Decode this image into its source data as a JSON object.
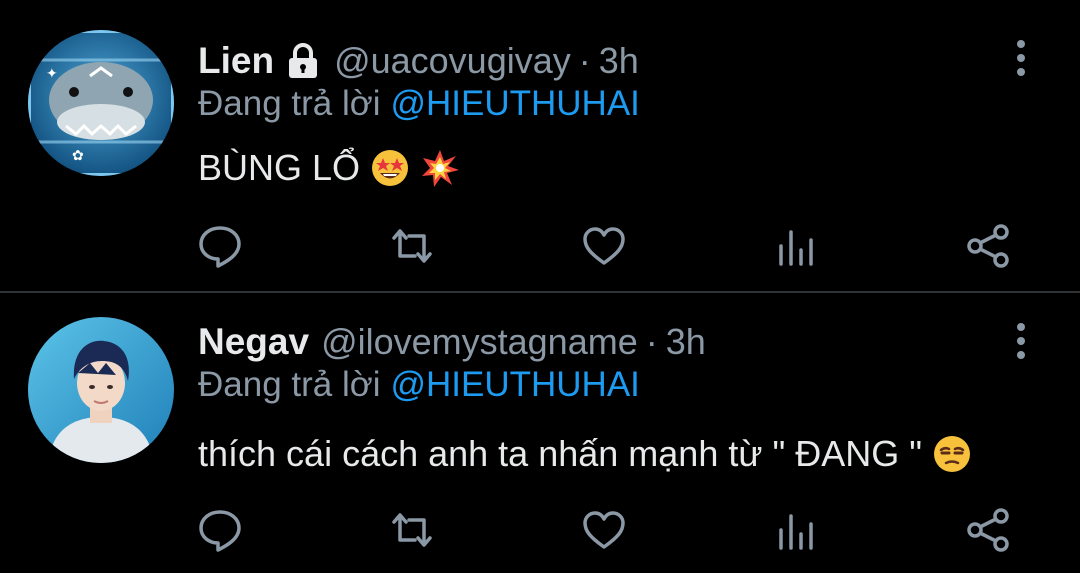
{
  "tweets": [
    {
      "display_name": "Lien",
      "protected": true,
      "handle": "@uacovugivay",
      "separator": "·",
      "time": "3h",
      "reply_prefix": "Đang trả lời",
      "reply_to": "@HIEUTHUHAI",
      "text": "BÙNG LỔ",
      "emojis": [
        "star-struck-emoji",
        "collision-emoji"
      ]
    },
    {
      "display_name": "Negav",
      "protected": false,
      "handle": "@ilovemystagname",
      "separator": "·",
      "time": "3h",
      "reply_prefix": "Đang trả lời",
      "reply_to": "@HIEUTHUHAI",
      "text": "thích cái cách anh ta nhấn mạnh từ \" ĐANG \"",
      "emojis": [
        "unamused-face-emoji"
      ]
    }
  ],
  "actions": [
    "reply-icon",
    "retweet-icon",
    "like-icon",
    "view-stats-icon",
    "share-icon"
  ],
  "colors": {
    "background": "#000000",
    "primary_text": "#e7e9ea",
    "secondary_text": "#8b98a5",
    "accent": "#1d9bf0",
    "divider": "#2f3336"
  }
}
